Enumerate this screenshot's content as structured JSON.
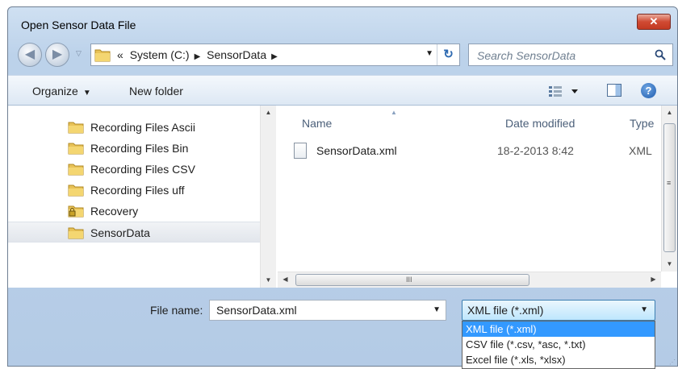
{
  "window": {
    "title": "Open Sensor Data File",
    "close_label": "✕"
  },
  "nav": {
    "back_icon": "back-arrow-icon",
    "forward_icon": "forward-arrow-icon",
    "breadcrumb_overflow": "«",
    "breadcrumbs": [
      "System (C:)",
      "SensorData"
    ],
    "refresh_icon": "refresh-icon",
    "search_placeholder": "Search SensorData"
  },
  "toolbar": {
    "organize_label": "Organize",
    "new_folder_label": "New folder",
    "views_icon": "views-icon",
    "preview_icon": "preview-pane-icon",
    "help_label": "?"
  },
  "sidebar": {
    "items": [
      {
        "label": "Recording Files Ascii",
        "icon": "folder-icon",
        "selected": false
      },
      {
        "label": "Recording Files Bin",
        "icon": "folder-icon",
        "selected": false
      },
      {
        "label": "Recording Files CSV",
        "icon": "folder-icon",
        "selected": false
      },
      {
        "label": "Recording Files uff",
        "icon": "folder-icon",
        "selected": false
      },
      {
        "label": "Recovery",
        "icon": "locked-folder-icon",
        "selected": false
      },
      {
        "label": "SensorData",
        "icon": "folder-icon",
        "selected": true
      }
    ]
  },
  "files": {
    "columns": [
      "Name",
      "Date modified",
      "Type"
    ],
    "rows": [
      {
        "name": "SensorData.xml",
        "date": "18-2-2013 8:42",
        "type": "XML"
      }
    ],
    "hscroll_grip": "III",
    "vscroll_grip": "≡"
  },
  "bottom": {
    "file_name_label": "File name:",
    "file_name_value": "SensorData.xml",
    "filter_selected": "XML file (*.xml)",
    "filter_options": [
      "XML file (*.xml)",
      "CSV file (*.csv, *asc, *.txt)",
      "Excel file (*.xls, *xlsx)"
    ]
  },
  "colors": {
    "frame": "#bcd2ea",
    "close_button": "#c33a22",
    "highlight": "#3399ff"
  }
}
